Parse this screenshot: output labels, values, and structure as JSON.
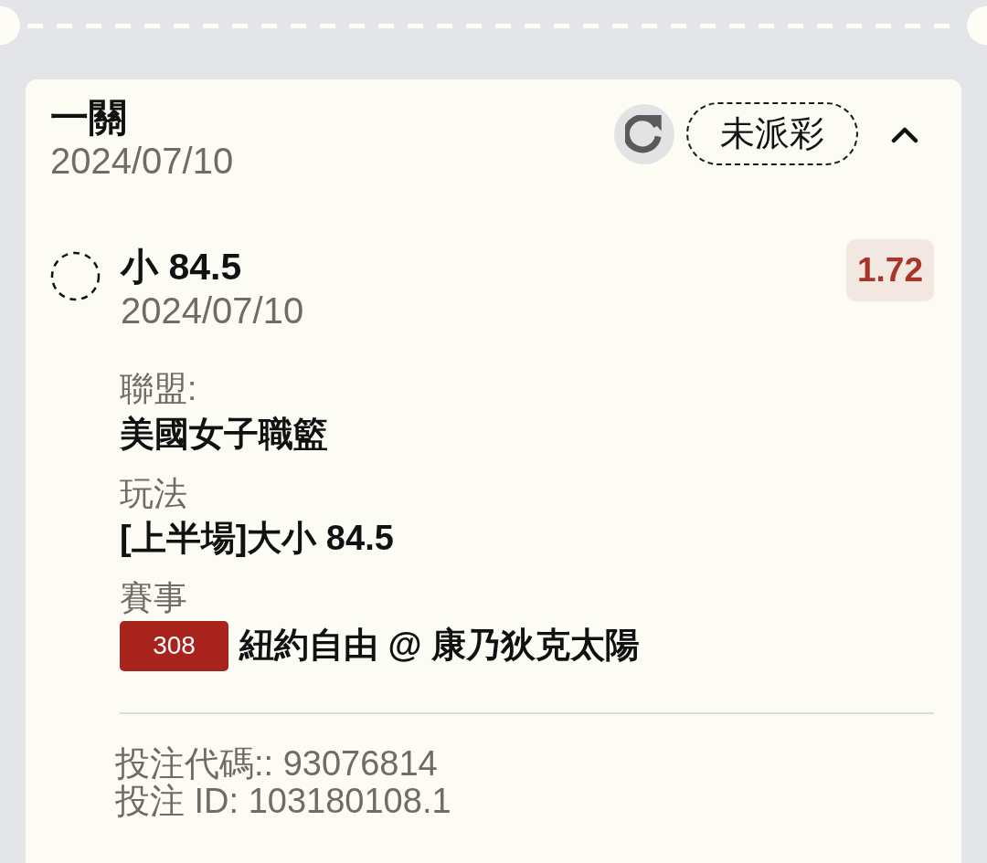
{
  "ticket": {
    "title": "一關",
    "date": "2024/07/10",
    "status": "未派彩",
    "expanded": true
  },
  "selection": {
    "name": "小 84.5",
    "date": "2024/07/10",
    "odds": "1.72"
  },
  "details": [
    {
      "kind": "text",
      "label": "聯盟:",
      "value": "美國女子職籃"
    },
    {
      "kind": "text",
      "label": "玩法",
      "value": "[上半場]大小 84.5"
    },
    {
      "kind": "match",
      "label": "賽事",
      "match_number": "308",
      "value": "紐約自由 @ 康乃狄克太陽"
    }
  ],
  "footer": [
    "投注代碼:: 93076814",
    "投注 ID: 103180108.1"
  ]
}
